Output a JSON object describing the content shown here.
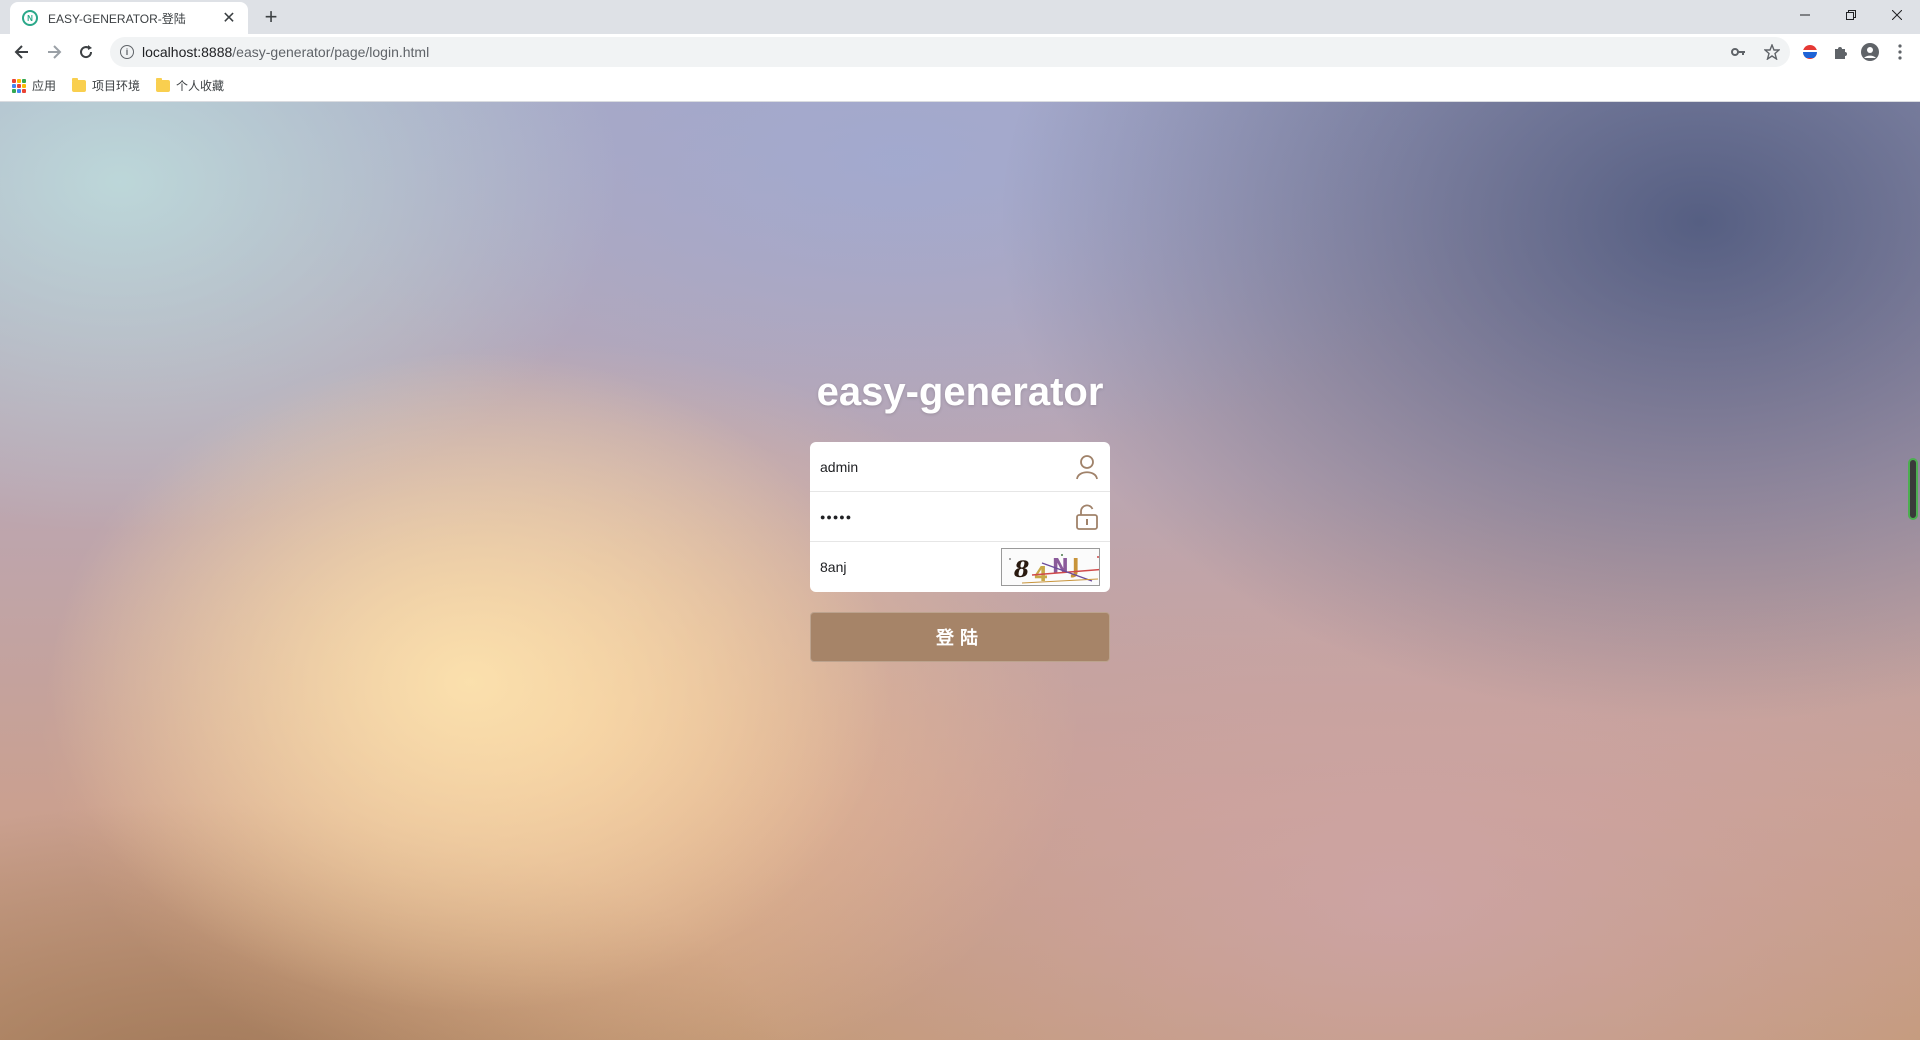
{
  "browser": {
    "tab_title": "EASY-GENERATOR-登陆",
    "tab_favicon_letter": "N",
    "url_host": "localhost:8888",
    "url_path": "/easy-generator/page/login.html",
    "bookmarks": [
      {
        "label": "应用",
        "icon": "apps-icon"
      },
      {
        "label": "项目环境",
        "icon": "folder-icon"
      },
      {
        "label": "个人收藏",
        "icon": "folder-icon"
      }
    ]
  },
  "login": {
    "title": "easy-generator",
    "username_value": "admin",
    "password_value": "●●●●●",
    "captcha_value": "8anj",
    "captcha_image_text": "84NJ",
    "submit_label": "登陆"
  },
  "colors": {
    "button_bg": "#a68468",
    "icon_color": "#a0826a"
  }
}
